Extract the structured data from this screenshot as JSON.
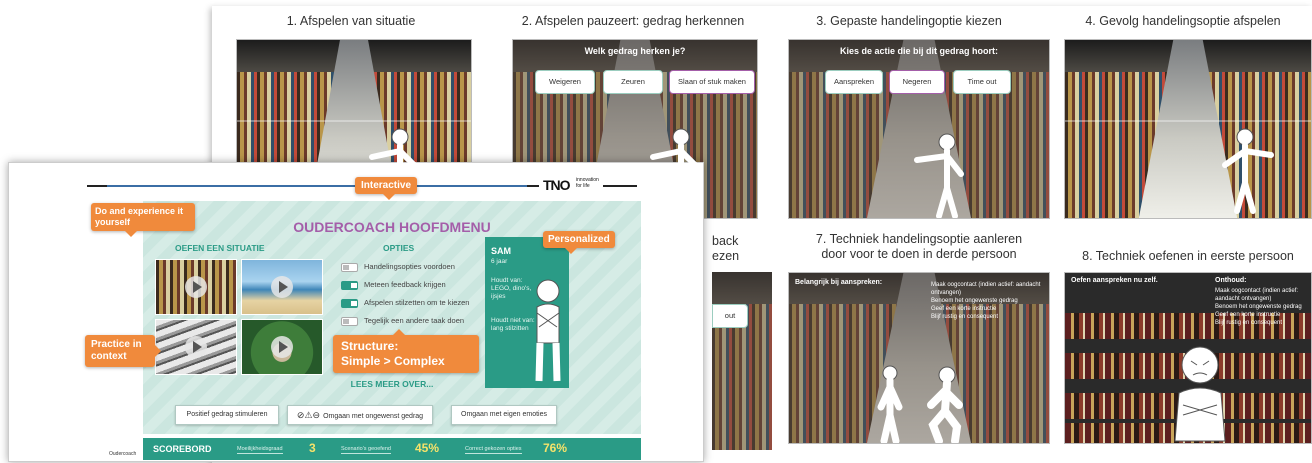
{
  "storyboard": {
    "steps": [
      {
        "title": "1. Afspelen van situatie"
      },
      {
        "title": "2. Afspelen pauzeert: gedrag herkennen"
      },
      {
        "title": "3. Gepaste handelingoptie kiezen"
      },
      {
        "title": "4. Gevolg handelingsoptie afspelen"
      },
      {
        "title_line1": "back",
        "title_line2": "ezen"
      },
      {
        "title_line1": "7. Techniek handelingsoptie aanleren",
        "title_line2": "door voor te doen in derde persoon"
      },
      {
        "title": "8. Techniek oefenen in eerste persoon"
      }
    ],
    "step2": {
      "question": "Welk gedrag herken je?",
      "choices": [
        "Weigeren",
        "Zeuren",
        "Slaan of stuk maken"
      ]
    },
    "step3": {
      "question": "Kies de actie die bij dit gedrag hoort:",
      "choices": [
        "Aanspreken",
        "Negeren",
        "Time out"
      ]
    },
    "step5_button": "out",
    "step7": {
      "heading": "Belangrijk bij aanspreken:",
      "bullets": [
        "Maak oogcontact (indien actief: aandacht ontvangen)",
        "Benoem het ongewenste gedrag",
        "Geef een korte instructie",
        "Blijf rustig en consequent"
      ]
    },
    "step8": {
      "heading": "Oefen aanspreken nu zelf.",
      "subheading": "Onthoud:",
      "bullets": [
        "Maak oogcontact (indien actief: aandacht ontvangen)",
        "Benoem het ongewenste gedrag",
        "Geef een korte instructie",
        "Blijf rustig en consequent"
      ]
    }
  },
  "app": {
    "brand": "TNO",
    "brand_tagline_1": "innovation",
    "brand_tagline_2": "for life",
    "menu_title": "OUDERCOACH HOOFDMENU",
    "col_situatie": "OEFEN EEN SITUATIE",
    "col_opties": "OPTIES",
    "options": [
      {
        "label": "Handelingsopties voordoen",
        "on": false
      },
      {
        "label": "Meteen feedback krijgen",
        "on": true
      },
      {
        "label": "Afspelen stilzetten om te kiezen",
        "on": true
      },
      {
        "label": "Tegelijk een andere taak doen",
        "on": false
      }
    ],
    "profile": {
      "name": "SAM",
      "age": "6 jaar",
      "likes_label": "Houdt van:",
      "likes": "LEGO, dino's, ijsjes",
      "dislikes_label": "Houdt niet van:",
      "dislikes": "lang stilzitten"
    },
    "lees_meer": "LEES MEER OVER...",
    "lees_buttons": [
      "Positief gedrag stimuleren",
      "Omgaan met ongewenst gedrag",
      "Omgaan met eigen emoties"
    ],
    "lees_icons": "⊘⚠⊖",
    "footer_left": "Oudercoach",
    "scoreboard": {
      "label": "SCOREBORD",
      "items": [
        {
          "label": "Moeilijkheidsgraad",
          "value": "3"
        },
        {
          "label": "Scenario's geoefend",
          "value": "45%"
        },
        {
          "label": "Correct gekozen opties",
          "value": "76%"
        }
      ]
    }
  },
  "callouts": {
    "interactive": "Interactive",
    "do": "Do and experience it yourself",
    "personalized": "Personalized",
    "practice": "Practice in context",
    "structure_1": "Structure:",
    "structure_2": "Simple > Complex"
  },
  "colors": {
    "accent_teal": "#2a9b86",
    "accent_purple": "#a45ea9",
    "callout_orange": "#f08a3c",
    "score_yellow": "#f7e36a"
  }
}
